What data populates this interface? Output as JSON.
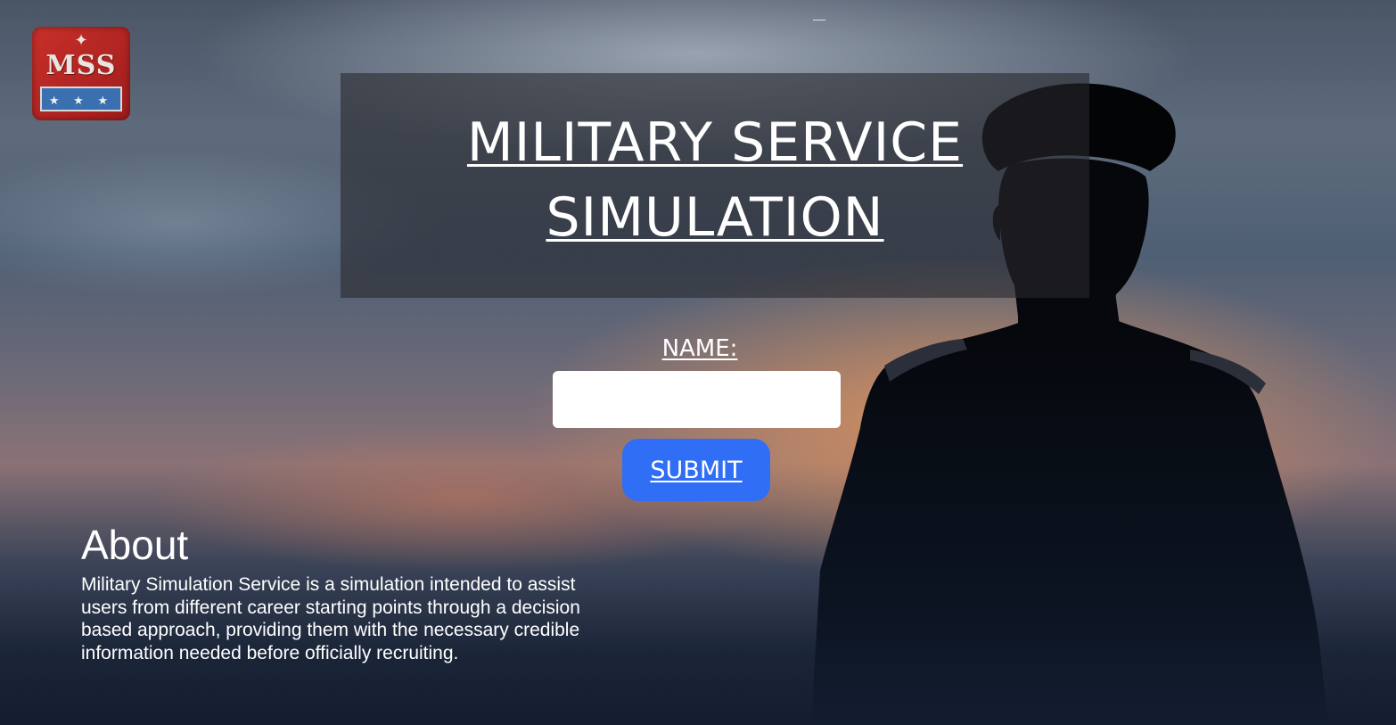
{
  "logo": {
    "letters": "MSS",
    "stars": "★ ★ ★"
  },
  "header": {
    "title_line1": "MILITARY SERVICE",
    "title_line2": "SIMULATION"
  },
  "form": {
    "name_label": "NAME:",
    "name_value": "",
    "submit_label": "SUBMIT"
  },
  "about": {
    "heading": "About",
    "text": "Military Simulation Service is a simulation intended to assist users from different career starting points through a decision based approach, providing them with the necessary credible information needed before officially recruiting."
  },
  "colors": {
    "submit_button": "#2f6ef5",
    "logo_red": "#c8302a",
    "logo_blue": "#3a6fb0"
  }
}
